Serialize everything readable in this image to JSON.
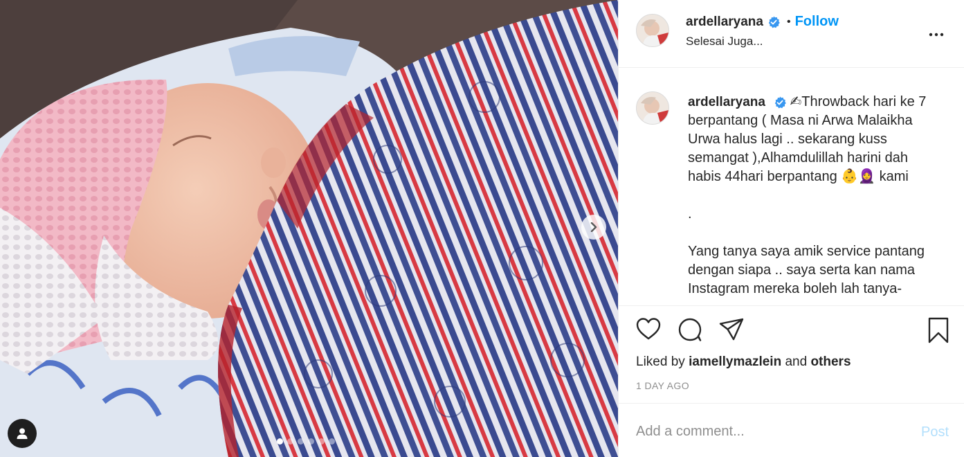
{
  "post": {
    "photo_alt": "",
    "carousel": {
      "count": 6,
      "active_index": 0
    }
  },
  "header": {
    "username": "ardellaryana",
    "separator": "•",
    "follow_label": "Follow",
    "location": "Selesai Juga..."
  },
  "caption": {
    "username": "ardellaryana",
    "line1": "✍Throwback hari ke 7 berpantang ( Masa ni Arwa Malaikha Urwa halus lagi .. sekarang kuss semangat ),Alhamdulillah harini dah habis 44hari berpantang 👶🧕 kami",
    "line2": ".",
    "line3": "Yang tanya saya amik service pantang dengan siapa .. saya serta kan nama Instagram mereka boleh lah tanya-"
  },
  "likes": {
    "prefix": "Liked by",
    "user": "iamellymazlein",
    "middle": "and",
    "others": "others"
  },
  "timestamp": "1 DAY AGO",
  "comment": {
    "placeholder": "Add a comment...",
    "post_label": "Post"
  },
  "icons": {
    "verified": "verified-badge-icon",
    "more": "more-options-icon",
    "like": "heart-icon",
    "comment": "comment-bubble-icon",
    "share": "paper-plane-icon",
    "save": "bookmark-icon",
    "next": "chevron-right-icon",
    "tag": "user-tag-icon"
  },
  "colors": {
    "accent": "#0095f6",
    "post_disabled": "#b2dffc",
    "verified": "#3897f0",
    "muted": "#8e8e8e"
  }
}
